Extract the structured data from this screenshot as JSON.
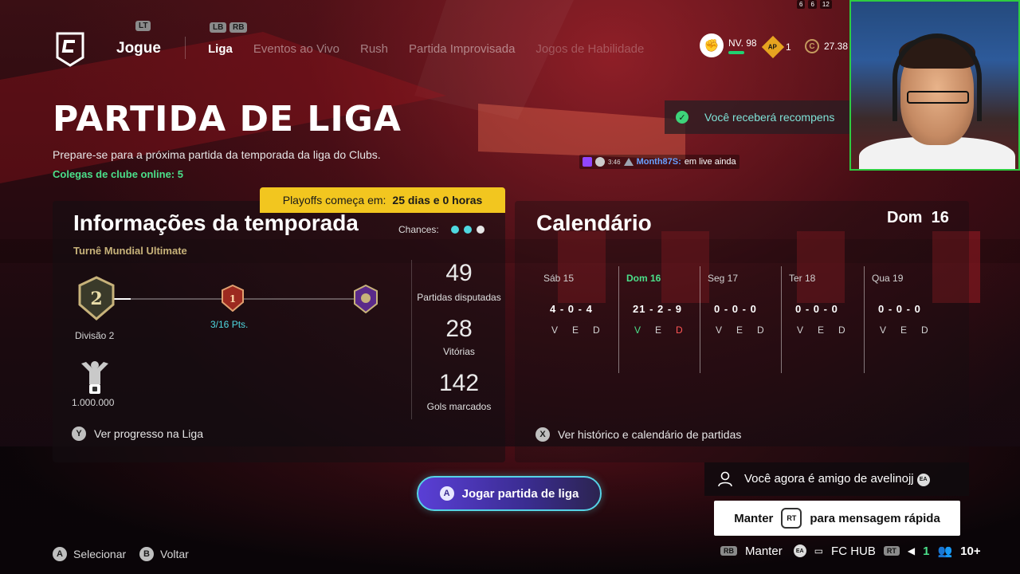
{
  "nav": {
    "lt": "LT",
    "lb": "LB",
    "rb": "RB",
    "jogue": "Jogue",
    "tabs": [
      {
        "label": "Liga"
      },
      {
        "label": "Eventos ao Vivo"
      },
      {
        "label": "Rush"
      },
      {
        "label": "Partida Improvisada"
      },
      {
        "label": "Jogos de Habilidade"
      }
    ],
    "level": "NV. 98",
    "level_progress": 0.2,
    "ap_icon": "AP",
    "ap_count": "1",
    "coins": "27.38",
    "coin_icon": "C"
  },
  "stream": {
    "icons": [
      "6",
      "6",
      "12"
    ],
    "chat": {
      "badge": "3:46",
      "user": "Month87S:",
      "message": "em live ainda"
    }
  },
  "toast": {
    "reward": "Você receberá recompens"
  },
  "header": {
    "title": "PARTIDA DE LIGA",
    "subtitle": "Prepare-se para a próxima partida da temporada da liga do Clubs.",
    "online": "Colegas de clube online: 5"
  },
  "playoffs": {
    "label": "Playoffs começa em:",
    "value": "25 dias e 0 horas"
  },
  "season": {
    "title": "Informações da temporada",
    "tour": "Turnê Mundial Ultimate",
    "chances_label": "Chances:",
    "chances_colors": [
      "#4fd8e0",
      "#4fd8e0",
      "#e6e6e6"
    ],
    "current_division_num": "2",
    "next_division_num": "1",
    "division_label": "Divisão 2",
    "points": "3/16 Pts.",
    "progress": 0.1875,
    "trophy_value": "1.000.000",
    "stats": [
      {
        "value": "49",
        "label": "Partidas disputadas"
      },
      {
        "value": "28",
        "label": "Vitórias"
      },
      {
        "value": "142",
        "label": "Gols marcados"
      }
    ],
    "progress_hint_button": "Y",
    "progress_hint": "Ver progresso na Liga"
  },
  "calendar": {
    "title": "Calendário",
    "date_day": "Dom",
    "date_num": "16",
    "days": [
      {
        "day": "Sáb 15",
        "score": "4 - 0 - 4",
        "today": false
      },
      {
        "day": "Dom 16",
        "score": "21 - 2 - 9",
        "today": true
      },
      {
        "day": "Seg 17",
        "score": "0 - 0 - 0",
        "today": false
      },
      {
        "day": "Ter 18",
        "score": "0 - 0 - 0",
        "today": false
      },
      {
        "day": "Qua 19",
        "score": "0 - 0 - 0",
        "today": false
      }
    ],
    "ved": [
      "V",
      "E",
      "D"
    ],
    "history_button": "X",
    "history_hint": "Ver histórico e calendário de partidas"
  },
  "play_button": {
    "key": "A",
    "label": "Jogar partida de liga"
  },
  "notification": {
    "friend_text": "Você agora é amigo de avelinojj",
    "ea": "EA",
    "quick_prefix": "Manter",
    "quick_key": "RT",
    "quick_suffix": "para mensagem rápida"
  },
  "bottom": {
    "select_key": "A",
    "select": "Selecionar",
    "back_key": "B",
    "back": "Voltar",
    "rb": "RB",
    "manter": "Manter",
    "ea": "EA",
    "hub": "FC HUB",
    "rt": "RT",
    "online_count": "1",
    "friends": "10+"
  }
}
